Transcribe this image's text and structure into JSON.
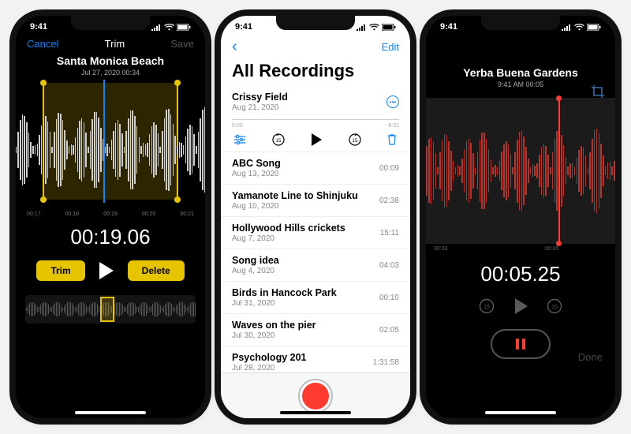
{
  "status_time": "9:41",
  "phone1": {
    "nav": {
      "cancel": "Cancel",
      "title": "Trim",
      "save": "Save"
    },
    "title": "Santa Monica Beach",
    "subtitle": "Jul 27, 2020   00:34",
    "axis": [
      "00:17",
      "00:18",
      "00:19",
      "00:20",
      "00:21"
    ],
    "time": "00:19.06",
    "trim_btn": "Trim",
    "delete_btn": "Delete"
  },
  "phone2": {
    "back": "‹",
    "edit": "Edit",
    "heading": "All Recordings",
    "top_item": {
      "name": "Crissy Field",
      "date": "Aug 21, 2020"
    },
    "scrub_left": "0:00",
    "scrub_right": "−8:31",
    "items": [
      {
        "name": "ABC Song",
        "date": "Aug 13, 2020",
        "dur": "00:09"
      },
      {
        "name": "Yamanote Line to Shinjuku",
        "date": "Aug 10, 2020",
        "dur": "02:38"
      },
      {
        "name": "Hollywood Hills crickets",
        "date": "Aug 7, 2020",
        "dur": "15:11"
      },
      {
        "name": "Song idea",
        "date": "Aug 4, 2020",
        "dur": "04:03"
      },
      {
        "name": "Birds in Hancock Park",
        "date": "Jul 31, 2020",
        "dur": "00:10"
      },
      {
        "name": "Waves on the pier",
        "date": "Jul 30, 2020",
        "dur": "02:05"
      },
      {
        "name": "Psychology 201",
        "date": "Jul 28, 2020",
        "dur": "1:31:58"
      }
    ]
  },
  "phone3": {
    "title": "Yerba Buena Gardens",
    "subtitle": "9:41 AM   00:05",
    "axis": [
      "00:03",
      "",
      "00:05",
      ""
    ],
    "time": "00:05.25",
    "done": "Done"
  }
}
